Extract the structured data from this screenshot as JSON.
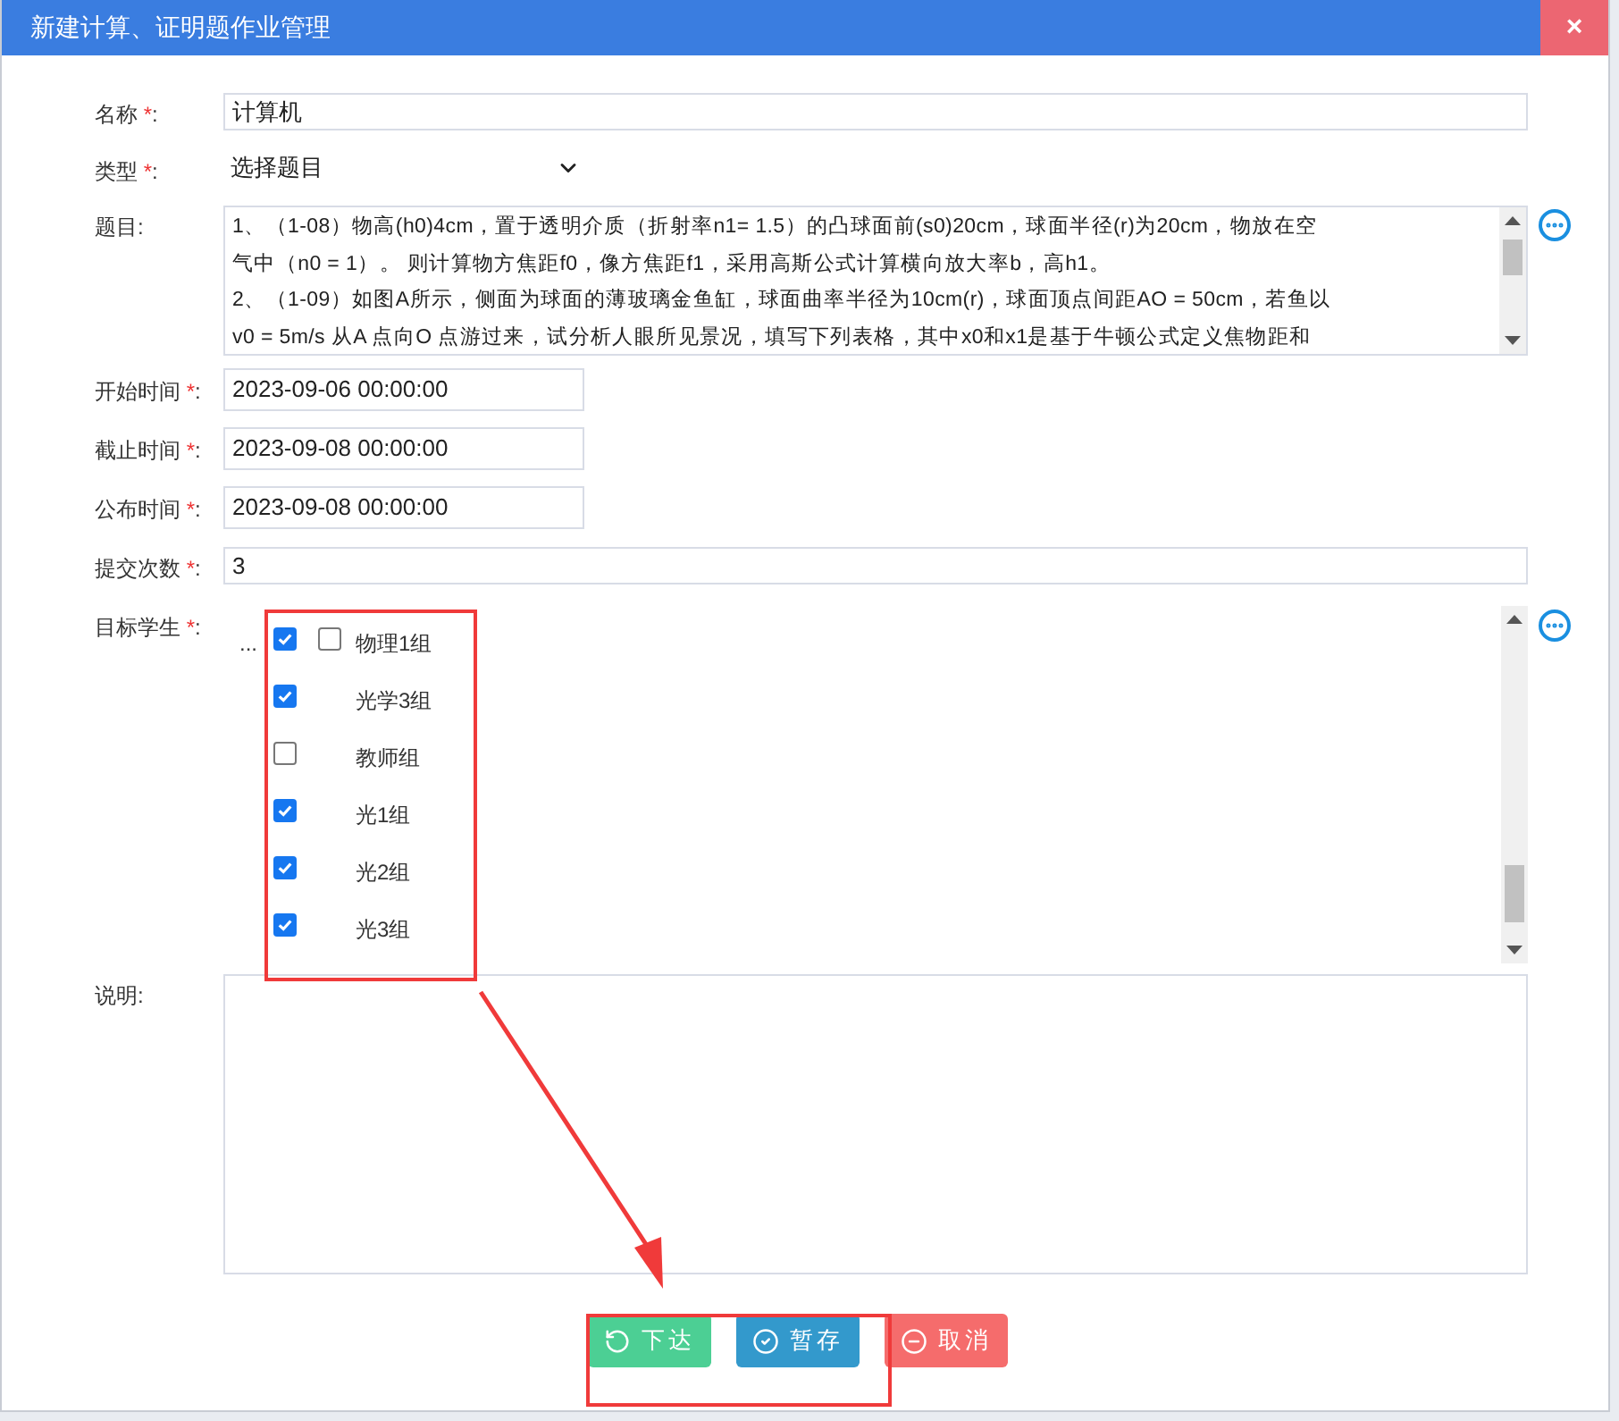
{
  "dialog": {
    "title": "新建计算、证明题作业管理",
    "close": "×"
  },
  "fields": [
    {
      "kind": "text",
      "label": "名称",
      "required": "*",
      "colon": ":",
      "value": "计算机"
    },
    {
      "kind": "select",
      "label": "类型",
      "required": "*",
      "colon": ":",
      "value": "选择题目"
    },
    {
      "kind": "problem",
      "label": "题目:",
      "lines": [
        "1、（1-08）物高(h0)4cm，置于透明介质（折射率n1= 1.5）的凸球面前(s0)20cm，球面半径(r)为20cm，物放在空",
        "气中（n0 = 1）。 则计算物方焦距f0，像方焦距f1，采用高斯公式计算横向放大率b，高h1。",
        "2、（1-09）如图A所示，侧面为球面的薄玻璃金鱼缸，球面曲率半径为10cm(r)，球面顶点间距AO = 50cm，若鱼以",
        "v0 = 5m/s 从A 点向O 点游过来，试分析人眼所见景况，填写下列表格，其中x0和x1是基于牛顿公式定义焦物距和"
      ]
    },
    {
      "kind": "time",
      "label": "开始时间",
      "required": "*",
      "colon": ":",
      "value": "2023-09-06 00:00:00"
    },
    {
      "kind": "time",
      "label": "截止时间",
      "required": "*",
      "colon": ":",
      "value": "2023-09-08 00:00:00"
    },
    {
      "kind": "time",
      "label": "公布时间",
      "required": "*",
      "colon": ":",
      "value": "2023-09-08 00:00:00"
    },
    {
      "kind": "wide",
      "label": "提交次数",
      "required": "*",
      "colon": ":",
      "value": "3"
    }
  ],
  "targets": {
    "label": "目标学生",
    "required": "*",
    "colon": ":",
    "ellipsis": "...",
    "items": [
      {
        "kind": "group",
        "label": "物理1组",
        "checked": true,
        "group_checked": false
      },
      {
        "kind": "plain",
        "label": "光学3组",
        "checked": true
      },
      {
        "kind": "plain",
        "label": "教师组",
        "checked": false
      },
      {
        "kind": "plain",
        "label": "光1组",
        "checked": true
      },
      {
        "kind": "plain",
        "label": "光2组",
        "checked": true
      },
      {
        "kind": "plain",
        "label": "光3组",
        "checked": true
      }
    ]
  },
  "notes": {
    "label": "说明:"
  },
  "buttons": [
    {
      "kind": "submit",
      "label": "下达"
    },
    {
      "kind": "save",
      "label": "暂存"
    },
    {
      "kind": "cancel",
      "label": "取消"
    }
  ]
}
